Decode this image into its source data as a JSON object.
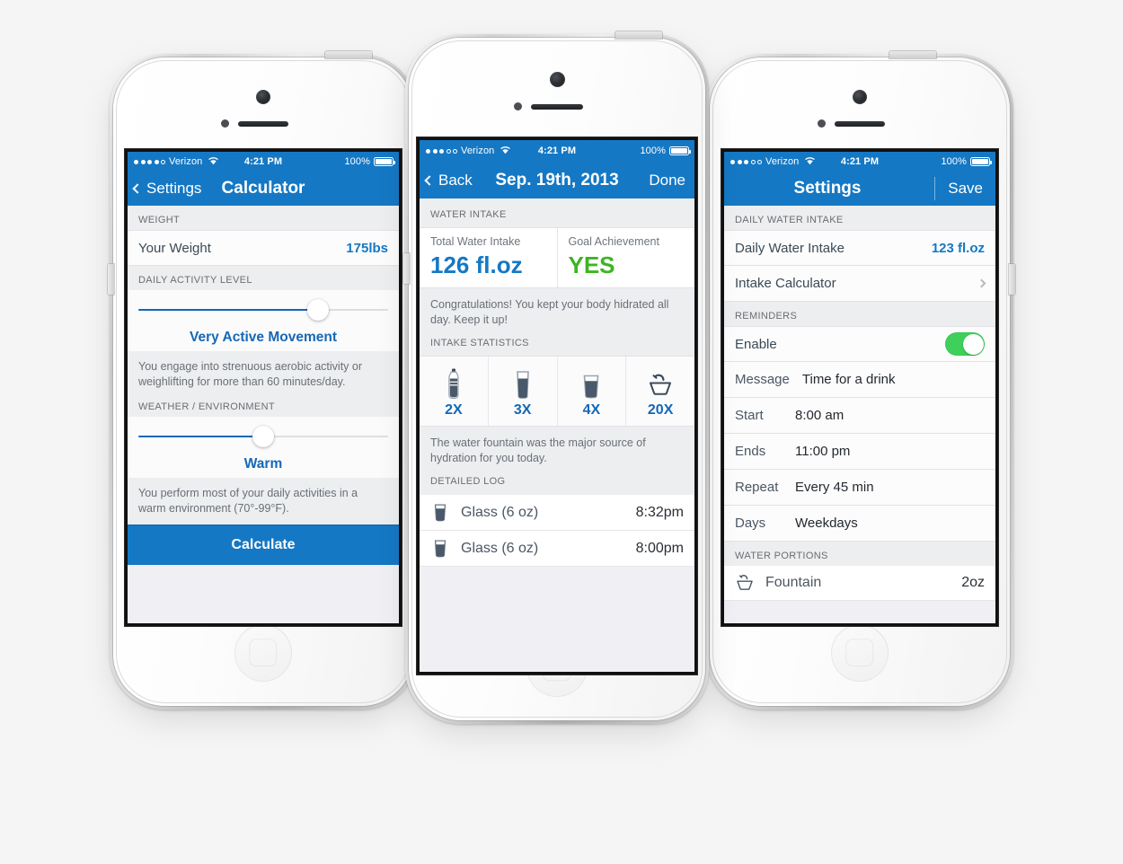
{
  "background_color": "#f5f5f5",
  "accent_blue": "#1578c4",
  "accent_green": "#3cb521",
  "toggle_green": "#3ed05a",
  "phones": {
    "left": {
      "name": "Intake Calculator screen",
      "statusbar": {
        "signal_filled": 4,
        "signal_total": 5,
        "carrier": "Verizon",
        "time": "4:21 PM",
        "battery_percent": "100%"
      },
      "navbar": {
        "back_label": "Settings",
        "title": "Calculator"
      },
      "sections": [
        {
          "header": "WEIGHT"
        },
        {
          "header": "DAILY ACTIVITY LEVEL"
        },
        {
          "header": "WEATHER / ENVIRONMENT"
        }
      ],
      "weight_row": {
        "label": "Your Weight",
        "value": "175lbs"
      },
      "activity_slider": {
        "label": "Very Active Movement",
        "percent": 72
      },
      "activity_note": "You engage into strenuous aerobic activity or weighlifting for more than 60 minutes/day.",
      "weather_slider": {
        "label": "Warm",
        "percent": 50
      },
      "weather_note": "You perform most of your daily activities in a warm environment (70°-99°F).",
      "calculate_button": "Calculate"
    },
    "center": {
      "name": "Daily log detail screen",
      "statusbar": {
        "signal_filled": 3,
        "signal_total": 5,
        "carrier": "Verizon",
        "time": "4:21 PM",
        "battery_percent": "100%"
      },
      "navbar": {
        "back_label": "Back",
        "title": "Sep. 19th, 2013",
        "right_label": "Done"
      },
      "water_intake_header": "WATER INTAKE",
      "summary": [
        {
          "caption": "Total Water Intake",
          "value": "126 fl.oz",
          "color": "blue"
        },
        {
          "caption": "Goal Achievement",
          "value": "YES",
          "color": "green"
        }
      ],
      "congrats_note": "Congratulations! You kept your body hidrated all day. Keep it up!",
      "intake_statistics_header": "INTAKE STATISTICS",
      "stats": [
        {
          "icon": "bottle-icon",
          "count": "2X"
        },
        {
          "icon": "tall-glass-icon",
          "count": "3X"
        },
        {
          "icon": "glass-icon",
          "count": "4X"
        },
        {
          "icon": "fountain-icon",
          "count": "20X"
        }
      ],
      "fountain_note": "The water fountain was the major source of hydration for you today.",
      "detailed_log_header": "DETAILED LOG",
      "log_entries": [
        {
          "icon": "glass-icon",
          "label": "Glass (6 oz)",
          "time": "8:32pm"
        },
        {
          "icon": "glass-icon",
          "label": "Glass (6 oz)",
          "time": "8:00pm"
        }
      ]
    },
    "right": {
      "name": "Settings screen",
      "statusbar": {
        "signal_filled": 3,
        "signal_total": 5,
        "carrier": "Verizon",
        "time": "4:21 PM",
        "battery_percent": "100%"
      },
      "navbar": {
        "title": "Settings",
        "right_label": "Save"
      },
      "daily_intake_header": "DAILY WATER INTAKE",
      "daily_intake_row": {
        "label": "Daily Water Intake",
        "value": "123 fl.oz"
      },
      "calculator_row": {
        "label": "Intake Calculator"
      },
      "reminders_header": "REMINDERS",
      "enable_row": {
        "label": "Enable",
        "state": "on"
      },
      "reminder_fields": [
        {
          "key": "Message",
          "value": "Time for a drink"
        },
        {
          "key": "Start",
          "value": "8:00 am"
        },
        {
          "key": "Ends",
          "value": "11:00 pm"
        },
        {
          "key": "Repeat",
          "value": "Every 45 min"
        },
        {
          "key": "Days",
          "value": "Weekdays"
        }
      ],
      "water_portions_header": "WATER PORTIONS",
      "portion_row": {
        "icon": "fountain-icon",
        "label": "Fountain",
        "value": "2oz"
      }
    }
  }
}
